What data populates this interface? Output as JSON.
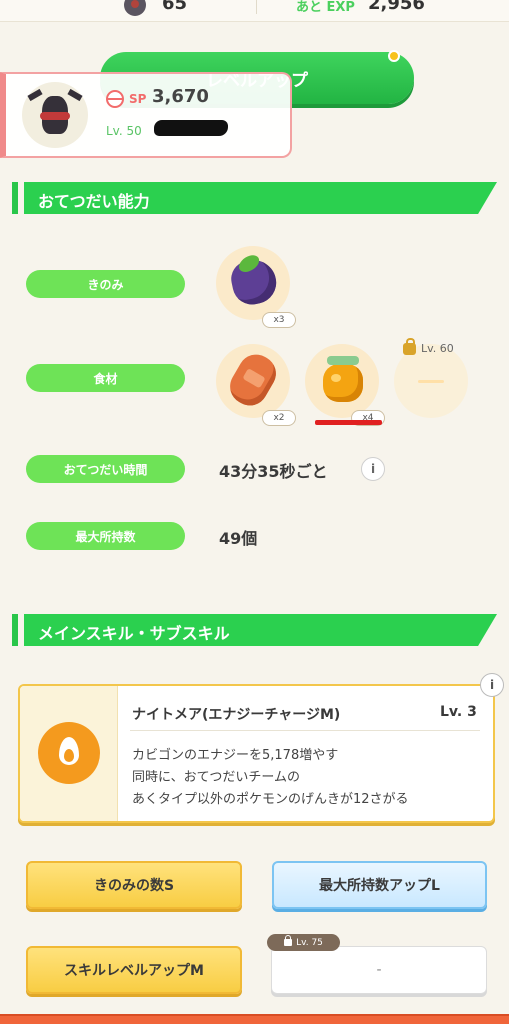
{
  "top_stats": {
    "candy_count": "65",
    "exp_label": "あと EXP",
    "exp_value": "2,956"
  },
  "level_up_button": {
    "label": "レベルアップ"
  },
  "pokemon_card": {
    "sp_label": "SP",
    "sp_value": "3,670",
    "level": "Lv. 50"
  },
  "sections": {
    "assist": "おてつだい能力",
    "skills": "メインスキル・サブスキル"
  },
  "assist": {
    "berry_label": "きのみ",
    "berry_count": "x3",
    "ingredient_label": "食材",
    "ingredients": [
      {
        "name": "bread-icon",
        "count": "x2"
      },
      {
        "name": "honey-jar-icon",
        "count": "x4"
      }
    ],
    "locked_ingredient_level": "Lv. 60",
    "frequency_label": "おてつだい時間",
    "frequency_value": "43分35秒ごと",
    "carry_label": "最大所持数",
    "carry_value": "49個"
  },
  "main_skill": {
    "name": "ナイトメア(エナジーチャージM)",
    "level": "Lv. 3",
    "desc_line1": "カビゴンのエナジーを5,178増やす",
    "desc_line2": "同時に、おてつだいチームの",
    "desc_line3": "あくタイプ以外のポケモンのげんきが12さがる"
  },
  "sub_skills": [
    {
      "label": "きのみの数S"
    },
    {
      "label": "最大所持数アップL"
    },
    {
      "label": "スキルレベルアップM"
    },
    {
      "label": "-"
    }
  ],
  "sub_skill_locked_level": "Lv. 75",
  "info_glyph": "i",
  "colors": {
    "accent_green": "#2bd04f",
    "label_green": "#6ee357",
    "gold": "#f8cd43",
    "blue": "#c9e8ff",
    "sp_red": "#f26c6c",
    "flame_orange": "#f49a1e"
  }
}
